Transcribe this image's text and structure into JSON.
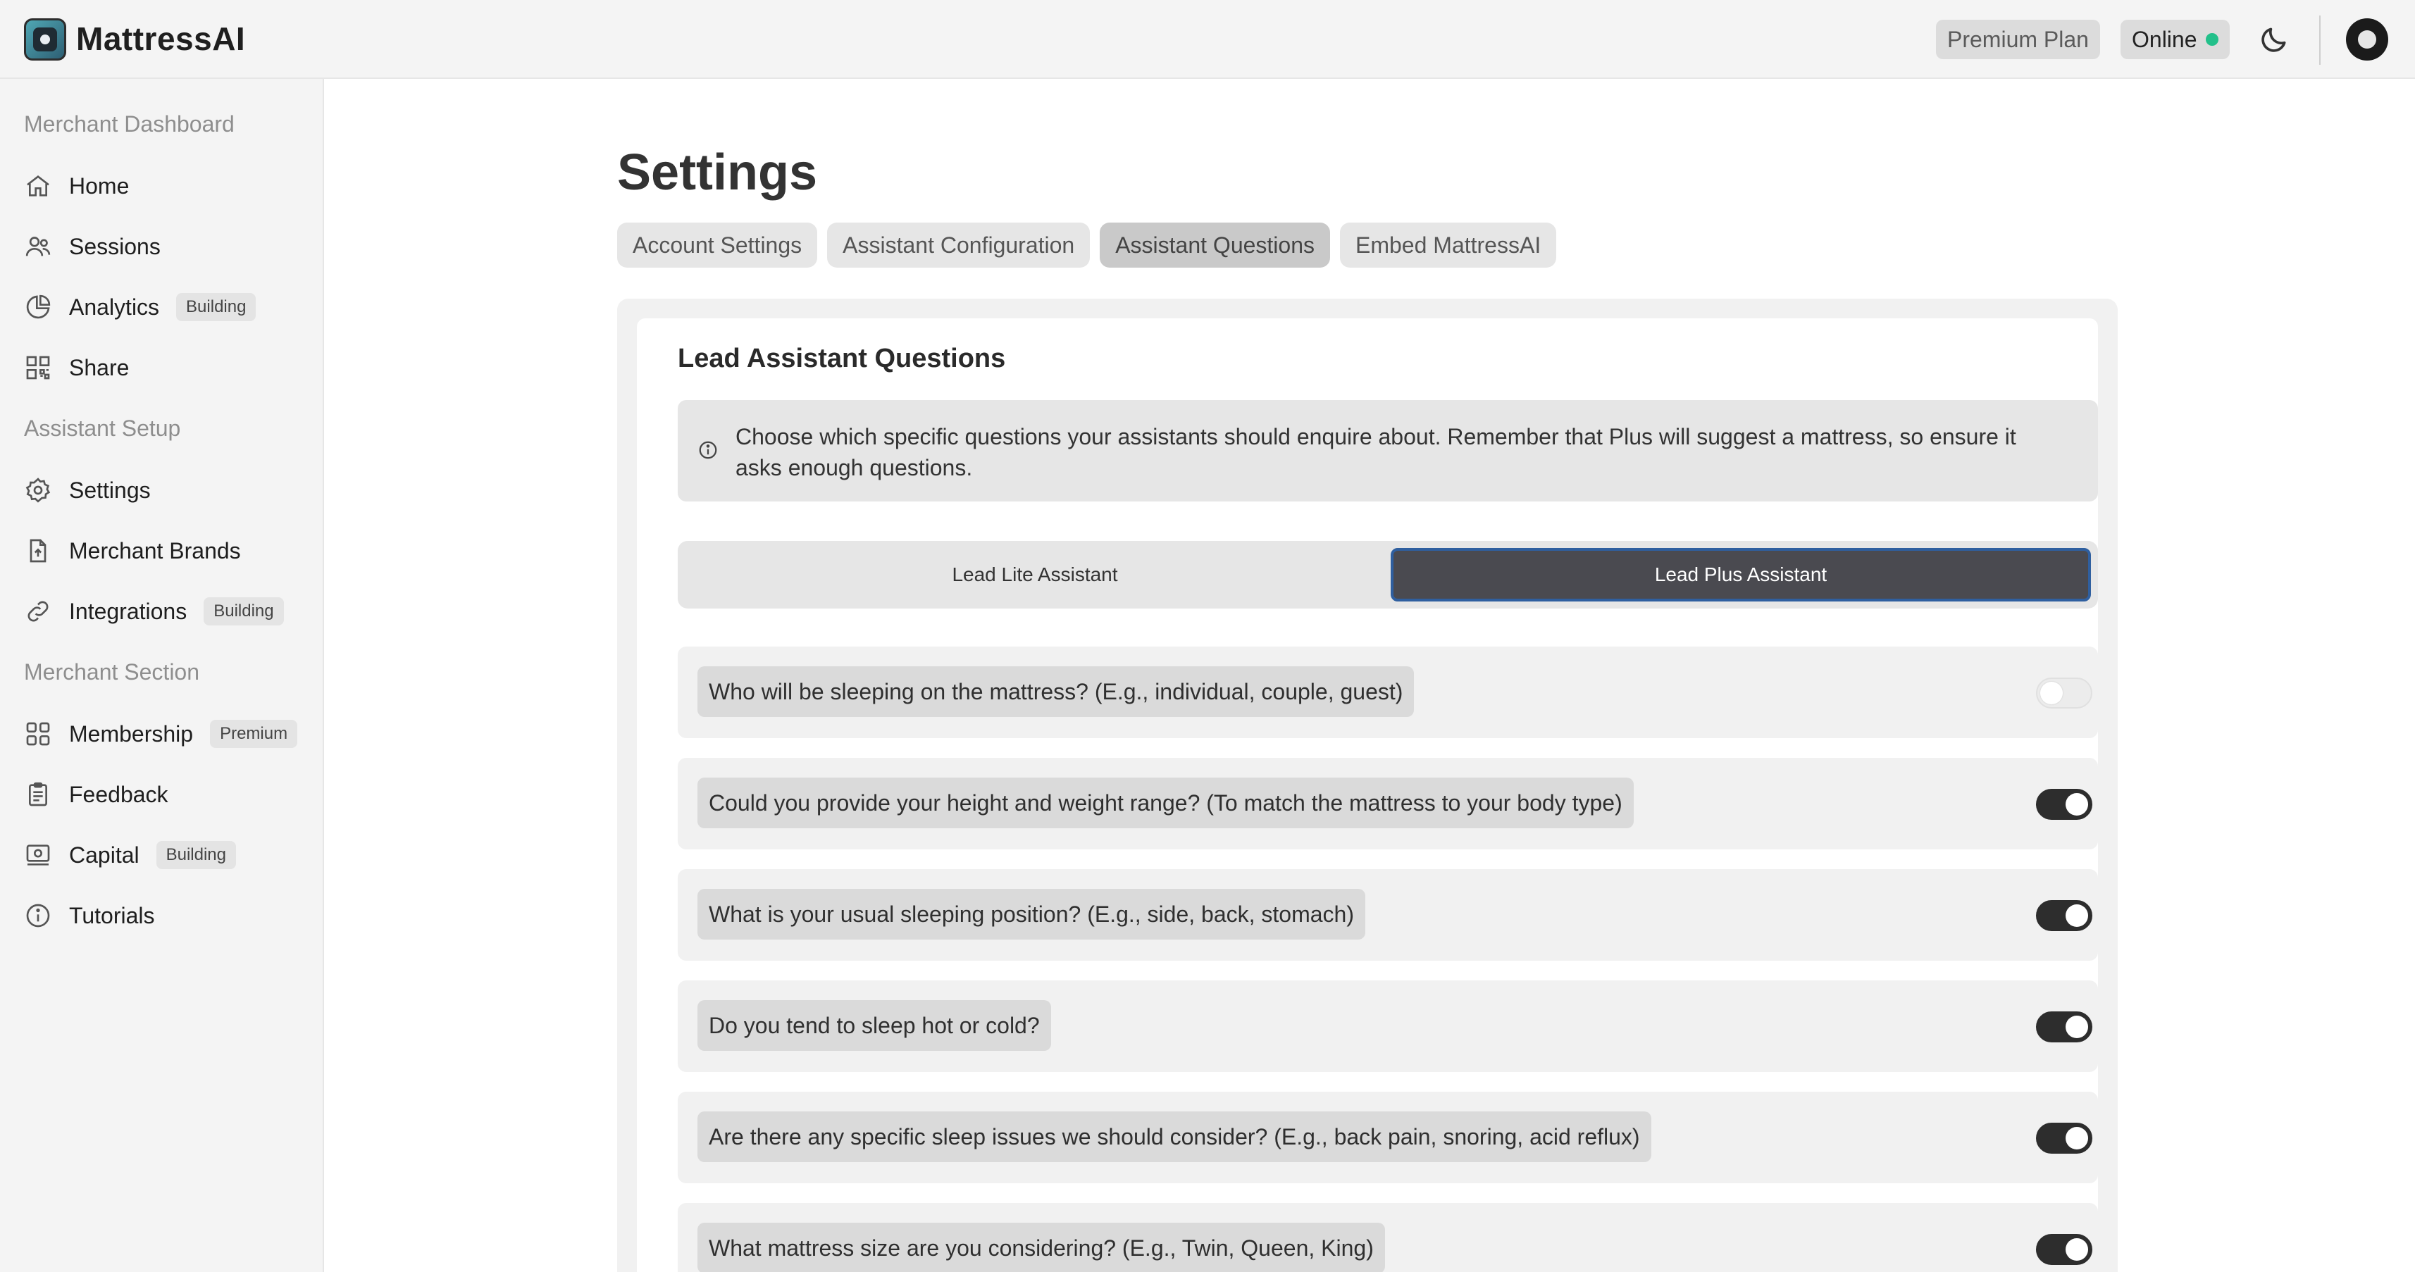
{
  "app": {
    "name": "MattressAI"
  },
  "header": {
    "plan_badge": "Premium Plan",
    "status_label": "Online",
    "status_color": "#22c08a",
    "theme_icon": "moon-icon",
    "avatar_icon": "user-avatar"
  },
  "sidebar": {
    "sections": [
      {
        "title": "Merchant Dashboard",
        "items": [
          {
            "label": "Home",
            "icon": "home-icon",
            "pill": ""
          },
          {
            "label": "Sessions",
            "icon": "users-icon",
            "pill": ""
          },
          {
            "label": "Analytics",
            "icon": "pie-chart-icon",
            "pill": "Building"
          },
          {
            "label": "Share",
            "icon": "qr-code-icon",
            "pill": ""
          }
        ]
      },
      {
        "title": "Assistant Setup",
        "items": [
          {
            "label": "Settings",
            "icon": "gear-icon",
            "pill": ""
          },
          {
            "label": "Merchant Brands",
            "icon": "file-upload-icon",
            "pill": ""
          },
          {
            "label": "Integrations",
            "icon": "link-icon",
            "pill": "Building"
          }
        ]
      },
      {
        "title": "Merchant Section",
        "items": [
          {
            "label": "Membership",
            "icon": "grid-icon",
            "pill": "Premium"
          },
          {
            "label": "Feedback",
            "icon": "clipboard-icon",
            "pill": ""
          },
          {
            "label": "Capital",
            "icon": "cash-icon",
            "pill": "Building"
          },
          {
            "label": "Tutorials",
            "icon": "info-icon",
            "pill": ""
          }
        ]
      }
    ]
  },
  "main": {
    "page_title": "Settings",
    "tabs": [
      {
        "label": "Account Settings",
        "active": false
      },
      {
        "label": "Assistant Configuration",
        "active": false
      },
      {
        "label": "Assistant Questions",
        "active": true
      },
      {
        "label": "Embed MattressAI",
        "active": false
      }
    ],
    "card": {
      "title": "Lead Assistant Questions",
      "info_text": "Choose which specific questions your assistants should enquire about. Remember that Plus will suggest a mattress, so ensure it asks enough questions.",
      "segment": {
        "options": [
          "Lead Lite Assistant",
          "Lead Plus Assistant"
        ],
        "selected": "Lead Plus Assistant"
      },
      "questions": [
        {
          "text": "Who will be sleeping on the mattress? (E.g., individual, couple, guest)",
          "enabled": false
        },
        {
          "text": "Could you provide your height and weight range? (To match the mattress to your body type)",
          "enabled": true
        },
        {
          "text": "What is your usual sleeping position? (E.g., side, back, stomach)",
          "enabled": true
        },
        {
          "text": "Do you tend to sleep hot or cold?",
          "enabled": true
        },
        {
          "text": "Are there any specific sleep issues we should consider? (E.g., back pain, snoring, acid reflux)",
          "enabled": true
        },
        {
          "text": "What mattress size are you considering? (E.g., Twin, Queen, King)",
          "enabled": true
        }
      ]
    }
  }
}
